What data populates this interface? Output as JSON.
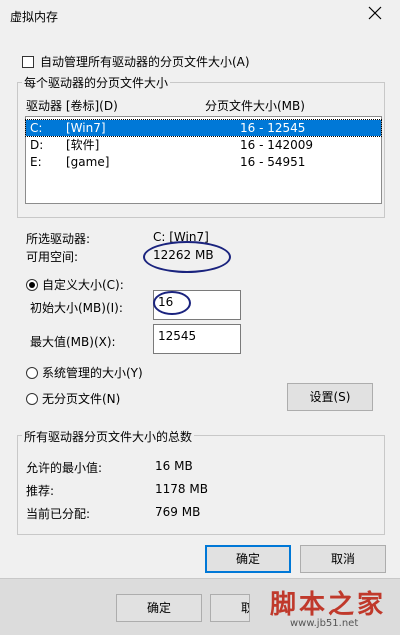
{
  "window": {
    "title": "虚拟内存"
  },
  "auto_manage": {
    "label": "自动管理所有驱动器的分页文件大小(A)",
    "checked": false
  },
  "drives_group": {
    "label": "每个驱动器的分页文件大小",
    "col_drive": "驱动器 [卷标](D)",
    "col_size": "分页文件大小(MB)",
    "rows": [
      {
        "drive": "C:",
        "label": "[Win7]",
        "size": "16 - 12545",
        "selected": true
      },
      {
        "drive": "D:",
        "label": "[软件]",
        "size": "16 - 142009",
        "selected": false
      },
      {
        "drive": "E:",
        "label": "[game]",
        "size": "16 - 54951",
        "selected": false
      }
    ]
  },
  "selected_drive": {
    "label": "所选驱动器:",
    "value": "C:  [Win7]"
  },
  "free_space": {
    "label": "可用空间:",
    "value": "12262 MB"
  },
  "custom_size": {
    "label": "自定义大小(C):",
    "selected": true
  },
  "initial_size": {
    "label": "初始大小(MB)(I):",
    "value": "16"
  },
  "max_size": {
    "label": "最大值(MB)(X):",
    "value": "12545"
  },
  "system_managed": {
    "label": "系统管理的大小(Y)",
    "selected": false
  },
  "no_paging": {
    "label": "无分页文件(N)",
    "selected": false
  },
  "set_button": {
    "label": "设置(S)"
  },
  "totals_group": {
    "label": "所有驱动器分页文件大小的总数",
    "min_label": "允许的最小值:",
    "min_value": "16 MB",
    "recommended_label": "推荐:",
    "recommended_value": "1178 MB",
    "current_label": "当前已分配:",
    "current_value": "769 MB"
  },
  "ok_button": {
    "label": "确定"
  },
  "cancel_button": {
    "label": "取消"
  },
  "footer": {
    "ok_label": "确定",
    "cut_label": "取"
  },
  "watermark": {
    "logo": "脚本之家",
    "url": "www.jb51.net"
  },
  "colors": {
    "selection": "#0078d7",
    "annotation": "#1a237e",
    "watermark": "#c0392b"
  }
}
